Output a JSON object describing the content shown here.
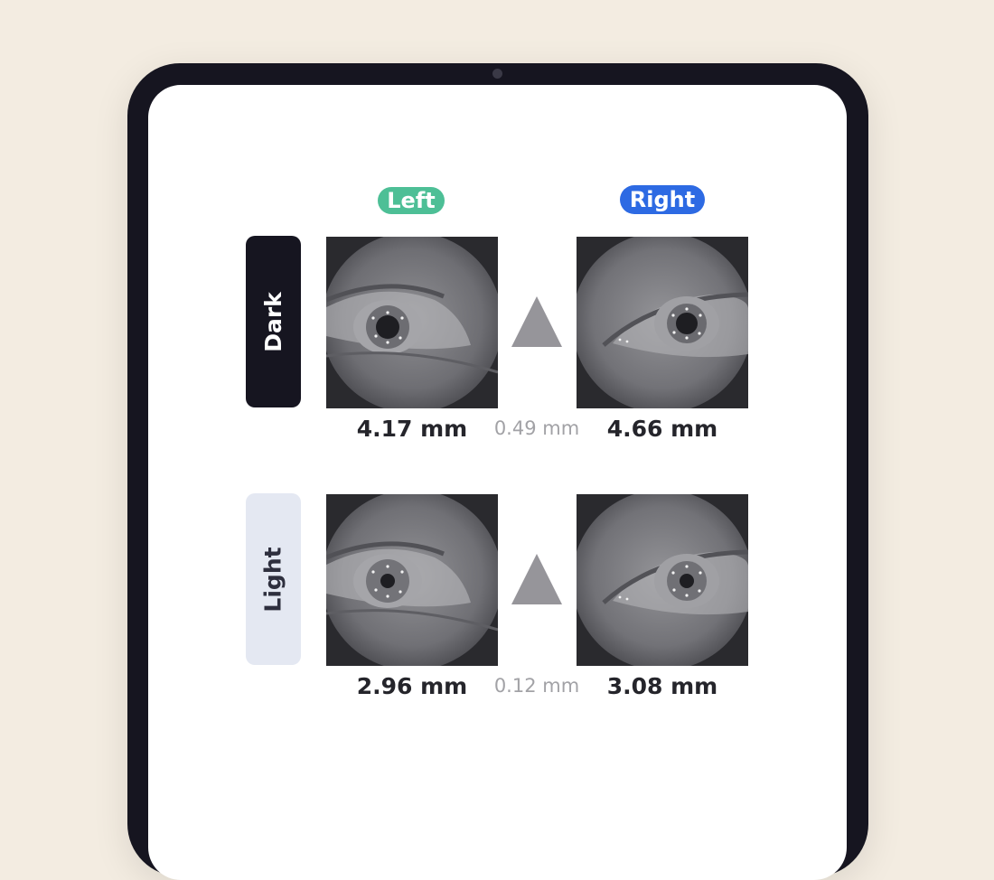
{
  "columns": {
    "left_label": "Left",
    "right_label": "Right"
  },
  "rows": [
    {
      "label": "Dark",
      "left_value": "4.17 mm",
      "difference": "0.49 mm",
      "right_value": "4.66 mm"
    },
    {
      "label": "Light",
      "left_value": "2.96 mm",
      "difference": "0.12 mm",
      "right_value": "3.08 mm"
    }
  ],
  "colors": {
    "left_accent": "#4dbf96",
    "right_accent": "#2d6ae3",
    "dark_row": "#161520",
    "light_row": "#e4e8f2",
    "delta_icon": "#96959a"
  }
}
